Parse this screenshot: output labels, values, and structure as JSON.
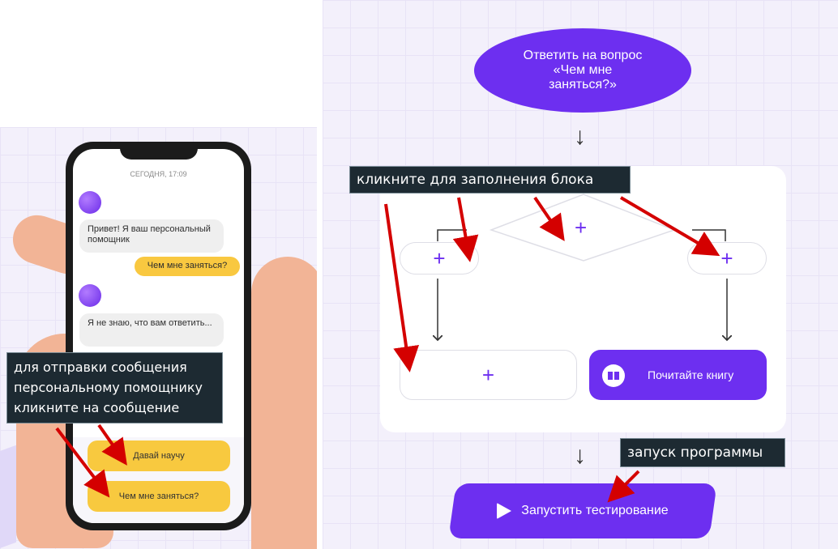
{
  "chat": {
    "timestamp": "СЕГОДНЯ, 17:09",
    "messages": [
      {
        "from": "bot",
        "text": "Привет! Я ваш персональный помощник"
      },
      {
        "from": "user",
        "text": "Чем мне заняться?"
      },
      {
        "from": "bot",
        "text": "Я не знаю, что вам ответить..."
      }
    ],
    "replies": [
      "Давай научу",
      "Чем мне заняться?"
    ]
  },
  "tooltips": {
    "send_message": "для отправки сообщения персональному помощнику кликните на сообщение",
    "fill_block": "кликните для заполнения блока",
    "run_program": "запуск программы"
  },
  "flow": {
    "start_node": "Ответить на вопрос «Чем мне заняться?»",
    "add_symbol": "+",
    "down_arrow": "↓",
    "read_book_label": "Почитайте книгу",
    "run_button_label": "Запустить тестирование"
  },
  "icons": {
    "book": "book-icon",
    "play": "play-icon"
  },
  "colors": {
    "accent": "#6d2ff0",
    "yellow": "#f9c840",
    "arrow_red": "#d40000",
    "tooltip_bg": "#1d2a32"
  }
}
